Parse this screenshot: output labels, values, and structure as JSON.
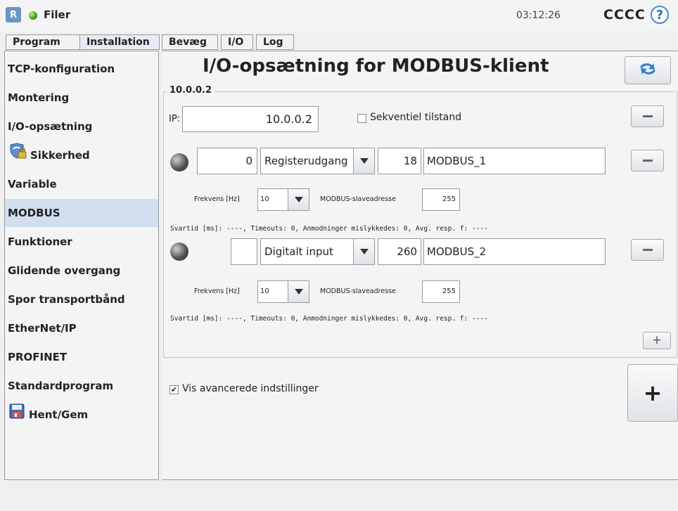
{
  "header": {
    "logo_text": "R",
    "menu_label": "Filer",
    "clock": "03:12:26",
    "robot_name": "CCCC",
    "help_symbol": "?"
  },
  "tabs": {
    "top": [
      {
        "label": "Program"
      },
      {
        "label": "Installation"
      }
    ],
    "sub": [
      {
        "label": "Bevæg"
      },
      {
        "label": "I/O"
      },
      {
        "label": "Log"
      }
    ]
  },
  "sidebar": {
    "items": [
      {
        "label": "TCP-konfiguration"
      },
      {
        "label": "Montering"
      },
      {
        "label": "I/O-opsætning"
      },
      {
        "label": "Sikkerhed"
      },
      {
        "label": "Variable"
      },
      {
        "label": "MODBUS"
      },
      {
        "label": "Funktioner"
      },
      {
        "label": "Glidende overgang"
      },
      {
        "label": "Spor transportbånd"
      },
      {
        "label": "EtherNet/IP"
      },
      {
        "label": "PROFINET"
      },
      {
        "label": "Standardprogram"
      },
      {
        "label": "Hent/Gem"
      }
    ],
    "selected": "MODBUS"
  },
  "main": {
    "title": "I/O-opsætning for MODBUS-klient",
    "group_label": "10.0.0.2",
    "ip_label": "IP:",
    "ip_value": "10.0.0.2",
    "sequential_label": "Sekventiel tilstand",
    "sequential_checked": false,
    "signals": [
      {
        "address": "0",
        "type": "Registerudgang",
        "register": "18",
        "name": "MODBUS_1",
        "freq_label": "Frekvens [Hz]",
        "freq_value": "10",
        "slave_label": "MODBUS-slaveadresse",
        "slave_value": "255",
        "stats": "Svartid [ms]: ----, Timeouts: 0, Anmodninger mislykkedes: 0, Avg. resp. f: ----"
      },
      {
        "address": "",
        "type": "Digitalt input",
        "register": "260",
        "name": "MODBUS_2",
        "freq_label": "Frekvens [Hz]",
        "freq_value": "10",
        "slave_label": "MODBUS-slaveadresse",
        "slave_value": "255",
        "stats": "Svartid [ms]: ----, Timeouts: 0, Anmodninger mislykkedes: 0, Avg. resp. f: ----"
      }
    ],
    "advanced_label": "Vis avancerede indstillinger",
    "advanced_checked": true,
    "add_signal_symbol": "+",
    "add_unit_symbol": "+"
  },
  "colors": {
    "selected_bg": "#d1dff0",
    "accent": "#2d6fb8",
    "status_green": "#2f8a12"
  }
}
